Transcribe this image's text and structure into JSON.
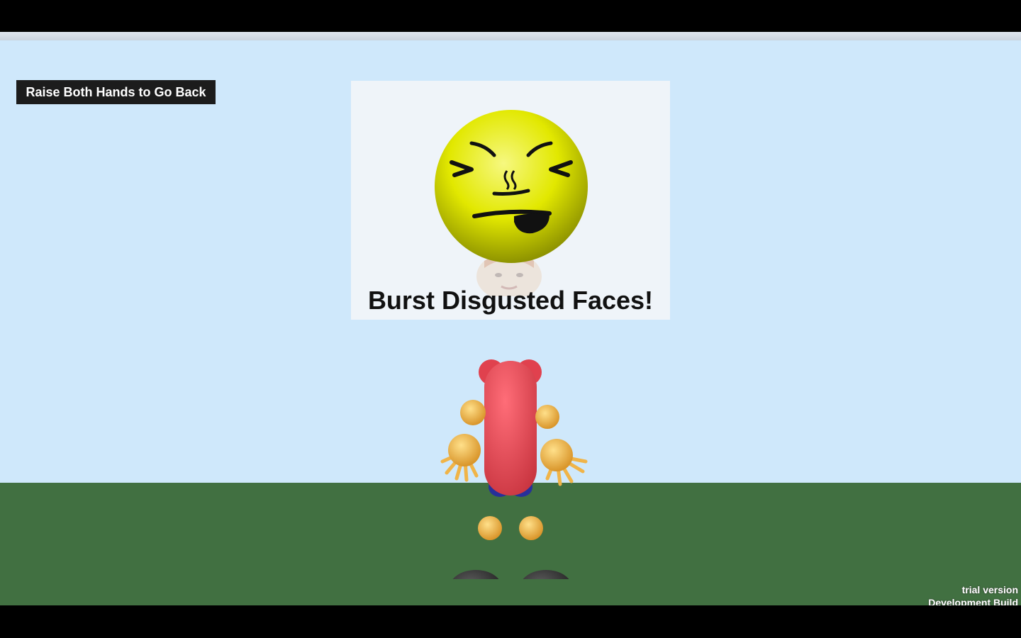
{
  "hud": {
    "back_hint": "Raise Both Hands to Go Back"
  },
  "panel": {
    "emoji": "disgusted-face-icon",
    "instruction": "Burst Disgusted Faces!"
  },
  "build": {
    "line1": "trial version",
    "line2": "Development Build"
  },
  "colors": {
    "sky": "#cfe8fb",
    "ground": "#417041",
    "face": "#e3ea00",
    "body": "#e84a58",
    "joints": "#f3b54a",
    "feet": "#3a3a3a"
  }
}
